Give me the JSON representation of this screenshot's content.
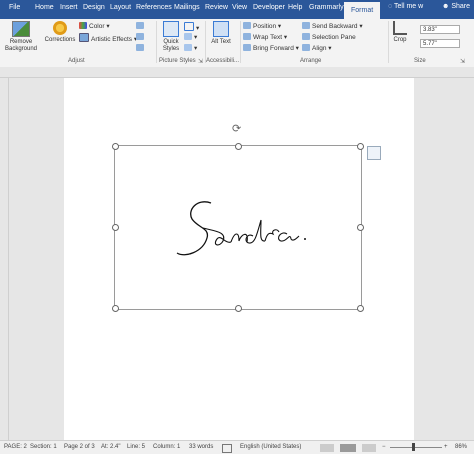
{
  "tabs": {
    "file": "File",
    "home": "Home",
    "insert": "Insert",
    "design": "Design",
    "layout": "Layout",
    "references": "References",
    "mailings": "Mailings",
    "review": "Review",
    "view": "View",
    "developer": "Developer",
    "help": "Help",
    "grammarly": "Grammarly",
    "format": "Format"
  },
  "tell_me": "Tell me w",
  "share": "Share",
  "ribbon": {
    "remove_background": "Remove Background",
    "corrections": "Corrections",
    "color": "Color",
    "artistic_effects": "Artistic Effects",
    "adjust_group": "Adjust",
    "quick_styles": "Quick Styles",
    "picture_styles_group": "Picture Styles",
    "alt_text": "Alt Text",
    "accessibility_group": "Accessibili...",
    "position": "Position",
    "wrap_text": "Wrap Text",
    "bring_forward": "Bring Forward",
    "send_backward": "Send Backward",
    "selection_pane": "Selection Pane",
    "align": "Align",
    "arrange_group": "Arrange",
    "crop": "Crop",
    "height": "3.83\"",
    "width": "5.77\"",
    "size_group": "Size"
  },
  "document": {
    "signature_text": "Sandra."
  },
  "status": {
    "page": "PAGE: 2",
    "section": "Section: 1",
    "page_of": "Page 2 of 3",
    "at": "At: 2.4\"",
    "line": "Line: 5",
    "column": "Column: 1",
    "words": "33 words",
    "language": "English (United States)",
    "zoom": "86%"
  },
  "colors": {
    "ribbon_blue": "#2b579a",
    "accent_icon": "#3a7bd5"
  },
  "icons": [
    "remove-background-icon",
    "corrections-icon",
    "color-icon",
    "artistic-effects-icon",
    "quick-styles-icon",
    "alt-text-icon",
    "position-icon",
    "wrap-text-icon",
    "crop-icon",
    "rotate-handle-icon",
    "layout-options-icon",
    "lightbulb-icon",
    "share-icon"
  ]
}
